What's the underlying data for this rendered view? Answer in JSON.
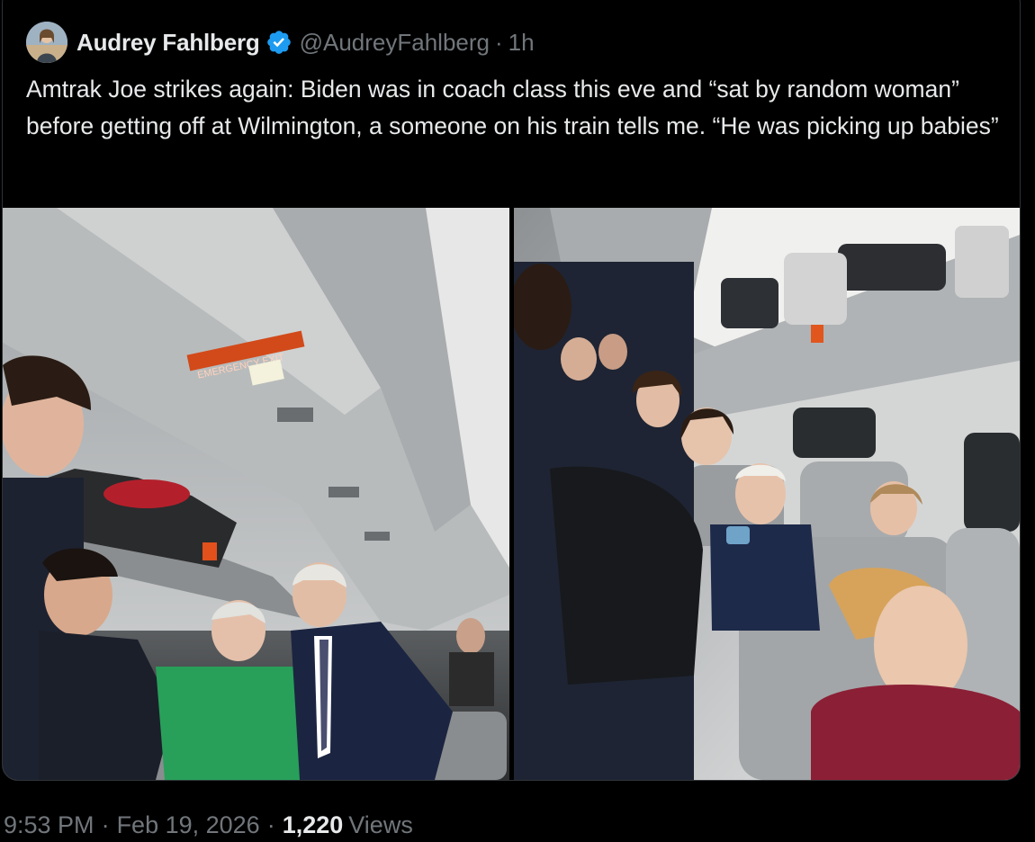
{
  "tweet": {
    "author_name": "Audrey Fahlberg",
    "handle": "@AudreyFahlberg",
    "separator": "·",
    "relative_time": "1h",
    "text": "Amtrak Joe strikes again: Biden was in coach class this eve and “sat by random woman” before getting off at Wilmington, a someone on his train tells me. “He was picking up babies”",
    "verified_color": "#1d9bf0"
  },
  "media": {
    "left_photo_sign": "EMERGENCY EXIT"
  },
  "footer": {
    "time": "9:53 PM",
    "date": "Feb 19, 2026",
    "views_count": "1,220",
    "views_label": "Views",
    "separator": "·"
  },
  "icons": {
    "verified": "verified-badge-icon"
  }
}
